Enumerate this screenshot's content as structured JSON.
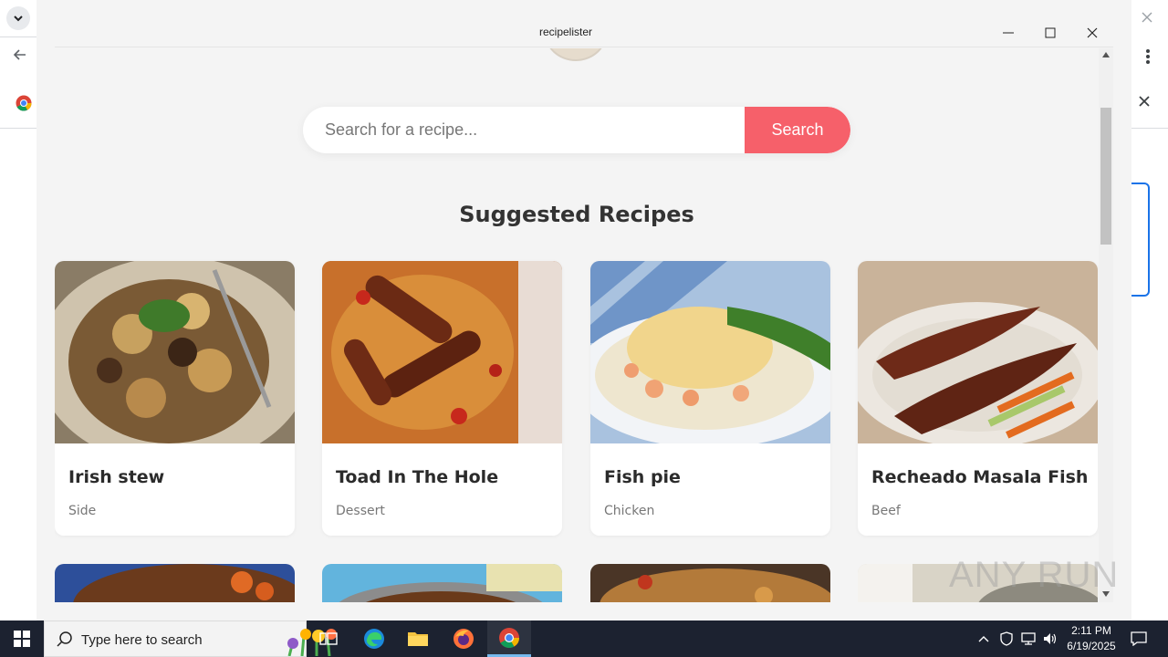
{
  "window": {
    "title": "recipelister"
  },
  "search": {
    "placeholder": "Search for a recipe...",
    "button_label": "Search"
  },
  "section_title": "Suggested Recipes",
  "recipes": [
    {
      "title": "Irish stew",
      "category": "Side"
    },
    {
      "title": "Toad In The Hole",
      "category": "Dessert"
    },
    {
      "title": "Fish pie",
      "category": "Chicken"
    },
    {
      "title": "Recheado Masala Fish",
      "category": "Beef"
    }
  ],
  "watermark": "ANY RUN",
  "taskbar": {
    "search_placeholder": "Type here to search",
    "time": "2:11 PM",
    "date": "6/19/2025"
  },
  "colors": {
    "accent": "#f6606a",
    "window_bg": "#f4f4f4",
    "taskbar_bg": "#1c2230"
  }
}
